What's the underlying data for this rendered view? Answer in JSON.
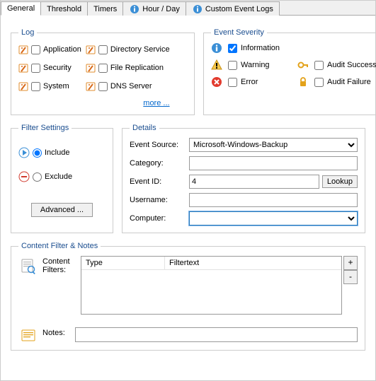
{
  "tabs": {
    "general": "General",
    "threshold": "Threshold",
    "timers": "Timers",
    "hour_day": "Hour / Day",
    "custom": "Custom Event Logs"
  },
  "log": {
    "legend": "Log",
    "application": "Application",
    "security": "Security",
    "system": "System",
    "directory": "Directory Service",
    "filerepl": "File Replication",
    "dns": "DNS Server",
    "more": "more ..."
  },
  "severity": {
    "legend": "Event Severity",
    "information": "Information",
    "warning": "Warning",
    "error": "Error",
    "audit_success": "Audit Success",
    "audit_failure": "Audit Failure"
  },
  "filter": {
    "legend": "Filter Settings",
    "include": "Include",
    "exclude": "Exclude",
    "advanced": "Advanced ..."
  },
  "details": {
    "legend": "Details",
    "event_source_label": "Event Source:",
    "event_source_value": "Microsoft-Windows-Backup",
    "category_label": "Category:",
    "category_value": "",
    "event_id_label": "Event ID:",
    "event_id_value": "4",
    "lookup": "Lookup",
    "username_label": "Username:",
    "username_value": "",
    "computer_label": "Computer:",
    "computer_value": ""
  },
  "content": {
    "legend": "Content Filter & Notes",
    "filters_label": "Content Filters:",
    "col_type": "Type",
    "col_filtertext": "Filtertext",
    "plus": "+",
    "minus": "-",
    "notes_label": "Notes:",
    "notes_value": ""
  }
}
